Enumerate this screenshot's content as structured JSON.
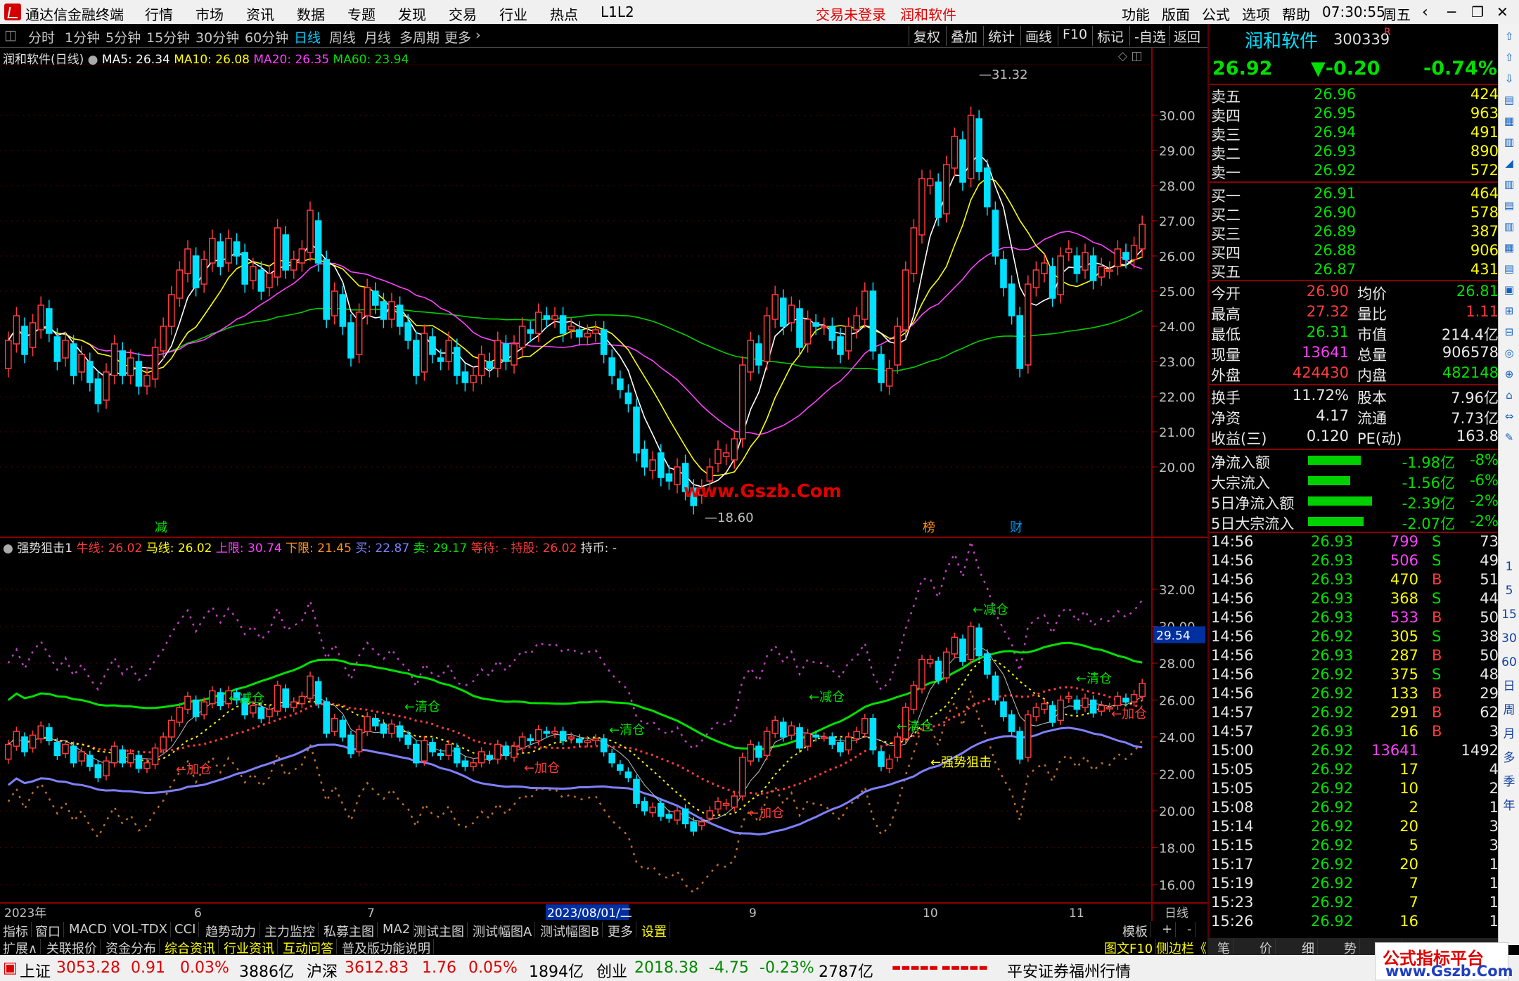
{
  "titlebar": {
    "app_name": "通达信金融终端",
    "menus": [
      "行情",
      "市场",
      "资讯",
      "数据",
      "专题",
      "发现",
      "交易",
      "行业",
      "热点",
      "L1L2"
    ],
    "login_status": "交易未登录",
    "stock_name": "润和软件",
    "right_menus": [
      "功能",
      "版面",
      "公式",
      "选项",
      "帮助"
    ],
    "time": "07:30:55",
    "weekday": "周五"
  },
  "period_bar": {
    "periods": [
      "分时",
      "1分钟",
      "5分钟",
      "15分钟",
      "30分钟",
      "60分钟",
      "日线",
      "周线",
      "月线",
      "多周期",
      "更多"
    ],
    "active": "日线",
    "tools": [
      "复权",
      "叠加",
      "统计",
      "画线",
      "F10",
      "标记",
      "-自选",
      "返回"
    ]
  },
  "main_chart": {
    "title": "润和软件(日线)",
    "ma_labels": [
      {
        "text": "MA5: 26.34",
        "color": "#ffffff"
      },
      {
        "text": "MA10: 26.08",
        "color": "#ffff00"
      },
      {
        "text": "MA20: 26.35",
        "color": "#ff40ff"
      },
      {
        "text": "MA60: 23.94",
        "color": "#00e000"
      }
    ],
    "high_label": "31.32",
    "low_label": "18.60",
    "watermark": "www.Gszb.Com",
    "markers": [
      "减",
      "榜",
      "财"
    ],
    "y_ticks": [
      "30.00",
      "29.00",
      "28.00",
      "27.00",
      "26.00",
      "25.00",
      "24.00",
      "23.00",
      "22.00",
      "21.00",
      "20.00"
    ]
  },
  "sub_chart": {
    "title": "强势狙击1",
    "legend": [
      {
        "text": "牛线: 26.02",
        "color": "#ff3b3b"
      },
      {
        "text": "马线: 26.02",
        "color": "#ffff00"
      },
      {
        "text": "上限: 30.74",
        "color": "#ff40ff"
      },
      {
        "text": "下限: 21.45",
        "color": "#ff9020"
      },
      {
        "text": "买: 22.87",
        "color": "#8080ff"
      },
      {
        "text": "卖: 29.17",
        "color": "#00e000"
      },
      {
        "text": "等待: -",
        "color": "#ff3b3b"
      },
      {
        "text": "持股: 26.02",
        "color": "#ff3b3b"
      },
      {
        "text": "持币: -",
        "color": "#e0e0e0"
      }
    ],
    "y_ticks": [
      "32.00",
      "30.00",
      "28.00",
      "26.00",
      "24.00",
      "22.00",
      "20.00",
      "18.00",
      "16.00"
    ],
    "current_value": "29.54",
    "annotations": {
      "add": "←加仓",
      "reduce": "←减仓",
      "clear": "←清仓",
      "snipe": "←强势狙击"
    }
  },
  "x_axis": {
    "labels": [
      "2023年",
      "6",
      "7",
      "2023/08/01/二",
      "9",
      "10",
      "11"
    ],
    "period": "日线"
  },
  "bottom_tabs_1": [
    "指标",
    "窗口",
    "MACD",
    "VOL-TDX",
    "CCI",
    "趋势动力",
    "主力监控",
    "私募主图",
    "MA2",
    "测试主图",
    "测试幅图A",
    "测试幅图B",
    "更多",
    "设置"
  ],
  "bottom_tabs_1_right": [
    "模板",
    "+",
    "-"
  ],
  "bottom_tabs_2": [
    "扩展∧",
    "关联报价",
    "资金分布",
    "综合资讯",
    "行业资讯",
    "互动问答",
    "普及版功能说明"
  ],
  "bottom_tabs_2_right": [
    "图文F10",
    "侧边栏《"
  ],
  "quote": {
    "name": "润和软件",
    "code": "300339",
    "flag": "R",
    "price": "26.92",
    "change": "▼-0.20",
    "pct": "-0.74%",
    "asks": [
      {
        "label": "卖五",
        "price": "26.96",
        "vol": "424"
      },
      {
        "label": "卖四",
        "price": "26.95",
        "vol": "963"
      },
      {
        "label": "卖三",
        "price": "26.94",
        "vol": "491"
      },
      {
        "label": "卖二",
        "price": "26.93",
        "vol": "890"
      },
      {
        "label": "卖一",
        "price": "26.92",
        "vol": "572"
      }
    ],
    "bids": [
      {
        "label": "买一",
        "price": "26.91",
        "vol": "464"
      },
      {
        "label": "买二",
        "price": "26.90",
        "vol": "578"
      },
      {
        "label": "买三",
        "price": "26.89",
        "vol": "387"
      },
      {
        "label": "买四",
        "price": "26.88",
        "vol": "906"
      },
      {
        "label": "买五",
        "price": "26.87",
        "vol": "431"
      }
    ],
    "stats": [
      {
        "l1": "今开",
        "v1": "26.90",
        "c1": "up",
        "l2": "均价",
        "v2": "26.81",
        "c2": "dn"
      },
      {
        "l1": "最高",
        "v1": "27.32",
        "c1": "up",
        "l2": "量比",
        "v2": "1.11",
        "c2": "up"
      },
      {
        "l1": "最低",
        "v1": "26.31",
        "c1": "dn",
        "l2": "市值",
        "v2": "214.4亿",
        "c2": "wt"
      },
      {
        "l1": "现量",
        "v1": "13641",
        "c1": "mg",
        "l2": "总量",
        "v2": "906578",
        "c2": "wt"
      },
      {
        "l1": "外盘",
        "v1": "424430",
        "c1": "up",
        "l2": "内盘",
        "v2": "482148",
        "c2": "dn"
      }
    ],
    "stats2": [
      {
        "l1": "换手",
        "v1": "11.72%",
        "l2": "股本",
        "v2": "7.96亿"
      },
      {
        "l1": "净资",
        "v1": "4.17",
        "l2": "流通",
        "v2": "7.73亿"
      },
      {
        "l1": "收益(三)",
        "v1": "0.120",
        "l2": "PE(动)",
        "v2": "163.8"
      }
    ],
    "flows": [
      {
        "label": "净流入额",
        "value": "-1.98亿",
        "pct": "-8%",
        "bar": 0.58
      },
      {
        "label": "大宗流入",
        "value": "-1.56亿",
        "pct": "-6%",
        "bar": 0.46
      },
      {
        "label": "5日净流入额",
        "value": "-2.39亿",
        "pct": "-2%",
        "bar": 0.7
      },
      {
        "label": "5日大宗流入",
        "value": "-2.07亿",
        "pct": "-2%",
        "bar": 0.61
      }
    ],
    "ticks": [
      {
        "t": "14:56",
        "p": "26.93",
        "v": "799",
        "bs": "S",
        "n": "73",
        "vc": "mg"
      },
      {
        "t": "14:56",
        "p": "26.93",
        "v": "506",
        "bs": "S",
        "n": "49",
        "vc": "mg"
      },
      {
        "t": "14:56",
        "p": "26.93",
        "v": "470",
        "bs": "B",
        "n": "51",
        "vc": "yl"
      },
      {
        "t": "14:56",
        "p": "26.93",
        "v": "368",
        "bs": "S",
        "n": "44",
        "vc": "yl"
      },
      {
        "t": "14:56",
        "p": "26.93",
        "v": "533",
        "bs": "B",
        "n": "50",
        "vc": "mg"
      },
      {
        "t": "14:56",
        "p": "26.92",
        "v": "305",
        "bs": "S",
        "n": "38",
        "vc": "yl"
      },
      {
        "t": "14:56",
        "p": "26.93",
        "v": "287",
        "bs": "B",
        "n": "50",
        "vc": "yl"
      },
      {
        "t": "14:56",
        "p": "26.92",
        "v": "375",
        "bs": "S",
        "n": "48",
        "vc": "yl"
      },
      {
        "t": "14:56",
        "p": "26.92",
        "v": "133",
        "bs": "B",
        "n": "29",
        "vc": "yl"
      },
      {
        "t": "14:57",
        "p": "26.92",
        "v": "291",
        "bs": "B",
        "n": "62",
        "vc": "yl"
      },
      {
        "t": "14:57",
        "p": "26.93",
        "v": "16",
        "bs": "B",
        "n": "3",
        "vc": "yl"
      },
      {
        "t": "15:00",
        "p": "26.92",
        "v": "13641",
        "bs": "",
        "n": "1492",
        "vc": "mg"
      },
      {
        "t": "15:05",
        "p": "26.92",
        "v": "17",
        "bs": "",
        "n": "4",
        "vc": "yl"
      },
      {
        "t": "15:05",
        "p": "26.92",
        "v": "10",
        "bs": "",
        "n": "2",
        "vc": "yl"
      },
      {
        "t": "15:08",
        "p": "26.92",
        "v": "2",
        "bs": "",
        "n": "1",
        "vc": "yl"
      },
      {
        "t": "15:14",
        "p": "26.92",
        "v": "20",
        "bs": "",
        "n": "3",
        "vc": "yl"
      },
      {
        "t": "15:15",
        "p": "26.92",
        "v": "5",
        "bs": "",
        "n": "3",
        "vc": "yl"
      },
      {
        "t": "15:17",
        "p": "26.92",
        "v": "20",
        "bs": "",
        "n": "1",
        "vc": "yl"
      },
      {
        "t": "15:19",
        "p": "26.92",
        "v": "7",
        "bs": "",
        "n": "1",
        "vc": "yl"
      },
      {
        "t": "15:23",
        "p": "26.92",
        "v": "7",
        "bs": "",
        "n": "1",
        "vc": "yl"
      },
      {
        "t": "15:26",
        "p": "26.92",
        "v": "16",
        "bs": "",
        "n": "1",
        "vc": "yl"
      }
    ],
    "tabs": [
      "笔",
      "价",
      "细",
      "势",
      "联"
    ]
  },
  "side_toolbar": [
    "1",
    "5",
    "15",
    "30",
    "60",
    "日",
    "周",
    "月",
    "多",
    "季",
    "年"
  ],
  "statusbar": {
    "items": [
      {
        "name": "上证",
        "val": "3053.28",
        "chg": "0.91",
        "pct": "0.03%",
        "amt": "3886亿"
      },
      {
        "name": "沪深",
        "val": "3612.83",
        "chg": "1.76",
        "pct": "0.05%",
        "amt": "1894亿"
      },
      {
        "name": "创业",
        "val": "2018.38",
        "chg": "-4.75",
        "pct": "-0.23%",
        "amt": "2787亿"
      }
    ],
    "broker": "平安证券福州行情"
  },
  "watermark_box": {
    "line1": "公式指标平台",
    "line2": "www.Gszb.Com"
  },
  "chart_data": {
    "type": "candlestick",
    "title": "润和软件(日线)",
    "ylim": [
      18.0,
      31.5
    ],
    "high": 31.32,
    "low": 18.6,
    "x_labels": [
      "2023年",
      "6",
      "7",
      "2023/08/01/二",
      "9",
      "10",
      "11"
    ],
    "candles": [
      [
        22.8,
        23.6
      ],
      [
        23.5,
        24.3
      ],
      [
        24.0,
        23.2
      ],
      [
        23.4,
        24.1
      ],
      [
        23.9,
        24.6
      ],
      [
        24.5,
        23.8
      ],
      [
        23.7,
        23.0
      ],
      [
        23.1,
        23.6
      ],
      [
        23.5,
        22.6
      ],
      [
        22.7,
        23.2
      ],
      [
        23.0,
        22.4
      ],
      [
        22.5,
        21.8
      ],
      [
        21.9,
        22.7
      ],
      [
        22.6,
        23.5
      ],
      [
        23.3,
        22.6
      ],
      [
        22.6,
        23.1
      ],
      [
        23.0,
        22.3
      ],
      [
        22.3,
        22.6
      ],
      [
        22.5,
        23.4
      ],
      [
        23.3,
        24.0
      ],
      [
        24.0,
        24.9
      ],
      [
        24.8,
        25.6
      ],
      [
        25.5,
        26.2
      ],
      [
        26.0,
        25.1
      ],
      [
        25.2,
        25.9
      ],
      [
        25.8,
        26.5
      ],
      [
        26.4,
        25.7
      ],
      [
        25.8,
        26.5
      ],
      [
        26.4,
        26.0
      ],
      [
        26.1,
        25.2
      ],
      [
        25.3,
        25.7
      ],
      [
        25.6,
        25.0
      ],
      [
        25.1,
        25.5
      ],
      [
        25.4,
        26.8
      ],
      [
        26.6,
        25.6
      ],
      [
        25.6,
        25.9
      ],
      [
        25.8,
        26.2
      ],
      [
        26.1,
        27.3
      ],
      [
        27.0,
        25.8
      ],
      [
        25.9,
        24.2
      ],
      [
        24.3,
        25.0
      ],
      [
        24.9,
        24.0
      ],
      [
        24.1,
        23.1
      ],
      [
        23.2,
        24.4
      ],
      [
        24.3,
        25.1
      ],
      [
        25.0,
        24.6
      ],
      [
        24.7,
        24.2
      ],
      [
        24.2,
        24.7
      ],
      [
        24.6,
        24.0
      ],
      [
        24.1,
        23.6
      ],
      [
        23.6,
        22.6
      ],
      [
        22.7,
        23.8
      ],
      [
        23.7,
        23.2
      ],
      [
        23.1,
        23.0
      ],
      [
        23.0,
        23.6
      ],
      [
        23.4,
        22.6
      ],
      [
        22.7,
        22.4
      ],
      [
        22.4,
        22.6
      ],
      [
        22.6,
        23.2
      ],
      [
        23.0,
        22.8
      ],
      [
        22.8,
        23.6
      ],
      [
        23.5,
        23.0
      ],
      [
        22.9,
        23.5
      ],
      [
        23.4,
        24.0
      ],
      [
        23.9,
        23.8
      ],
      [
        23.8,
        24.4
      ],
      [
        24.3,
        24.2
      ],
      [
        24.2,
        24.3
      ],
      [
        24.3,
        23.8
      ],
      [
        23.9,
        24.0
      ],
      [
        23.9,
        23.7
      ],
      [
        23.7,
        23.8
      ],
      [
        23.8,
        23.9
      ],
      [
        23.9,
        23.2
      ],
      [
        23.1,
        22.6
      ],
      [
        22.5,
        22.2
      ],
      [
        22.1,
        21.8
      ],
      [
        21.7,
        20.4
      ],
      [
        20.5,
        20.0
      ],
      [
        19.9,
        20.2
      ],
      [
        20.4,
        19.7
      ],
      [
        19.8,
        19.6
      ],
      [
        19.5,
        20.0
      ],
      [
        20.1,
        19.3
      ],
      [
        19.4,
        18.9
      ],
      [
        19.2,
        19.4
      ],
      [
        19.6,
        20.0
      ],
      [
        20.1,
        20.5
      ],
      [
        20.3,
        20.4
      ],
      [
        20.2,
        20.8
      ],
      [
        20.8,
        22.9
      ],
      [
        22.7,
        23.6
      ],
      [
        23.5,
        22.9
      ],
      [
        23.0,
        24.3
      ],
      [
        24.2,
        24.9
      ],
      [
        24.8,
        24.0
      ],
      [
        24.1,
        24.6
      ],
      [
        24.5,
        23.4
      ],
      [
        23.5,
        24.2
      ],
      [
        24.1,
        24.0
      ],
      [
        24.0,
        24.0
      ],
      [
        24.0,
        23.6
      ],
      [
        23.7,
        23.2
      ],
      [
        23.3,
        24.0
      ],
      [
        23.9,
        24.3
      ],
      [
        24.2,
        25.0
      ],
      [
        25.0,
        23.3
      ],
      [
        23.2,
        22.4
      ],
      [
        22.3,
        22.8
      ],
      [
        22.9,
        24.0
      ],
      [
        23.9,
        25.6
      ],
      [
        25.5,
        26.8
      ],
      [
        26.6,
        28.2
      ],
      [
        28.0,
        28.2
      ],
      [
        28.1,
        27.1
      ],
      [
        27.2,
        28.6
      ],
      [
        28.5,
        29.4
      ],
      [
        29.3,
        28.1
      ],
      [
        28.2,
        30.0
      ],
      [
        29.9,
        28.4
      ],
      [
        28.5,
        27.4
      ],
      [
        27.3,
        26.0
      ],
      [
        25.9,
        25.1
      ],
      [
        25.2,
        24.3
      ],
      [
        24.3,
        22.8
      ],
      [
        22.9,
        25.2
      ],
      [
        25.1,
        25.6
      ],
      [
        25.5,
        25.8
      ],
      [
        25.7,
        24.8
      ],
      [
        24.9,
        26.0
      ],
      [
        26.1,
        26.2
      ],
      [
        26.0,
        25.5
      ],
      [
        25.6,
        26.1
      ],
      [
        26.0,
        25.3
      ],
      [
        25.4,
        25.7
      ],
      [
        25.6,
        25.6
      ],
      [
        25.7,
        26.2
      ],
      [
        26.1,
        25.9
      ],
      [
        25.9,
        26.3
      ],
      [
        26.2,
        26.9
      ]
    ]
  }
}
